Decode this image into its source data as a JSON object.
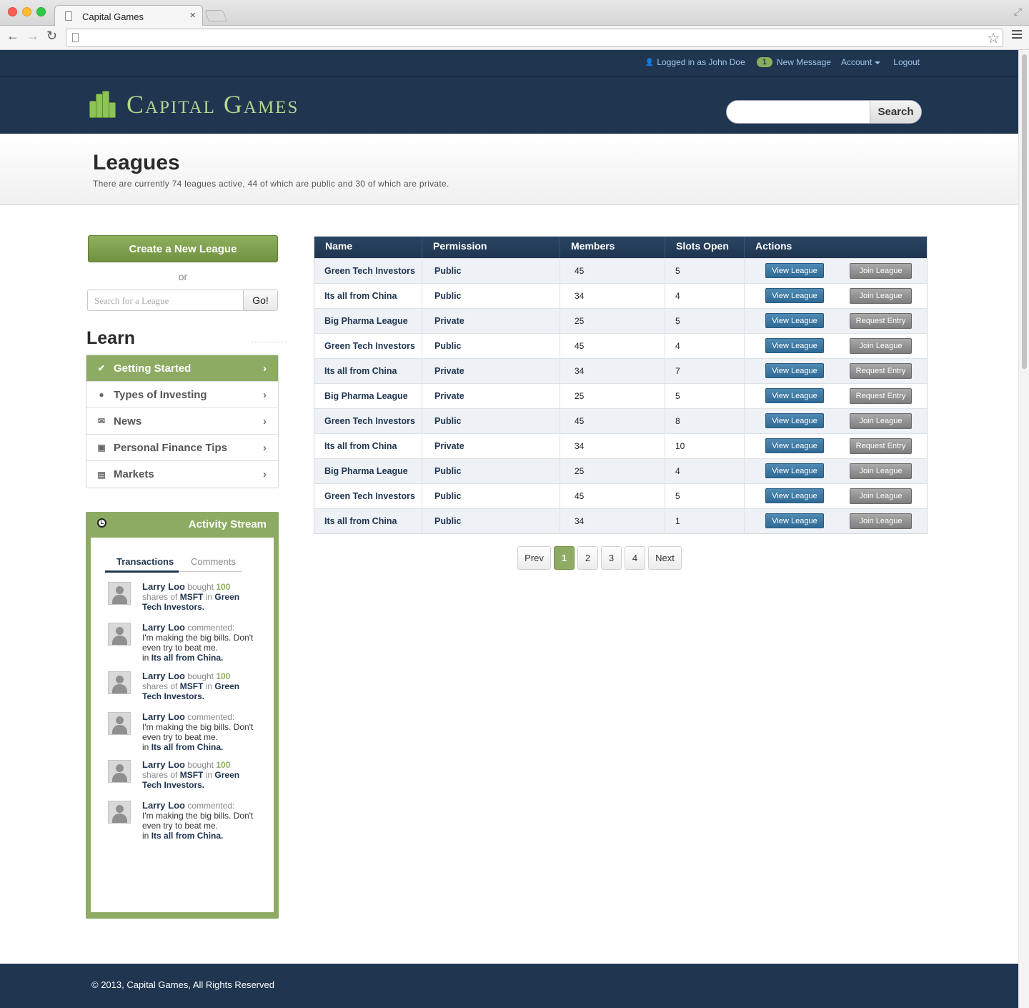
{
  "browser": {
    "tab_title": "Capital Games",
    "tab_close": "×"
  },
  "topbar": {
    "logged_in": "Logged in as John Doe",
    "message_count": "1",
    "new_message": "New Message",
    "account": "Account",
    "logout": "Logout"
  },
  "header": {
    "logo_text": "Capital Games",
    "search_button": "Search"
  },
  "title_band": {
    "title": "Leagues",
    "subtitle": "There are currently 74 leagues active, 44 of which are public and 30 of which are private."
  },
  "sidebar": {
    "create_button": "Create a New League",
    "or": "or",
    "search_placeholder": "Search for a League",
    "go_button": "Go!",
    "learn_title": "Learn",
    "learn_items": [
      {
        "label": "Getting Started",
        "icon": "check-icon"
      },
      {
        "label": "Types of Investing",
        "icon": "person-icon"
      },
      {
        "label": "News",
        "icon": "envelope-icon"
      },
      {
        "label": "Personal Finance Tips",
        "icon": "money-icon"
      },
      {
        "label": "Markets",
        "icon": "chart-icon"
      }
    ]
  },
  "activity": {
    "title": "Activity Stream",
    "tab_transactions": "Transactions",
    "tab_comments": "Comments",
    "feed": [
      {
        "name": "Larry Loo",
        "verb": "bought",
        "num": "100",
        "t1": "shares of",
        "stock": "MSFT",
        "t2": "in",
        "league": "Green Tech Investors."
      },
      {
        "name": "Larry Loo",
        "verb": "commented:",
        "msg": "I'm making the big bills. Don't even try to beat me.",
        "t2": "in",
        "league": "Its all from China."
      },
      {
        "name": "Larry Loo",
        "verb": "bought",
        "num": "100",
        "t1": "shares of",
        "stock": "MSFT",
        "t2": "in",
        "league": "Green Tech Investors."
      },
      {
        "name": "Larry Loo",
        "verb": "commented:",
        "msg": "I'm making the big bills. Don't even try to beat me.",
        "t2": "in",
        "league": "Its all from China."
      },
      {
        "name": "Larry Loo",
        "verb": "bought",
        "num": "100",
        "t1": "shares of",
        "stock": "MSFT",
        "t2": "in",
        "league": "Green Tech Investors."
      },
      {
        "name": "Larry Loo",
        "verb": "commented:",
        "msg": "I'm making the big bills. Don't even try to beat me.",
        "t2": "in",
        "league": "Its all from China."
      }
    ]
  },
  "table": {
    "headers": [
      "Name",
      "Permission",
      "Members",
      "Slots Open",
      "Actions"
    ],
    "view_label": "View League",
    "rows": [
      {
        "name": "Green Tech Investors",
        "perm": "Public",
        "members": "45",
        "slots": "5",
        "action": "Join League"
      },
      {
        "name": "Its all from China",
        "perm": "Public",
        "members": "34",
        "slots": "4",
        "action": "Join League"
      },
      {
        "name": "Big Pharma League",
        "perm": "Private",
        "members": "25",
        "slots": "5",
        "action": "Request Entry"
      },
      {
        "name": "Green Tech Investors",
        "perm": "Public",
        "members": "45",
        "slots": "4",
        "action": "Join League"
      },
      {
        "name": "Its all from China",
        "perm": "Private",
        "members": "34",
        "slots": "7",
        "action": "Request Entry"
      },
      {
        "name": "Big Pharma League",
        "perm": "Private",
        "members": "25",
        "slots": "5",
        "action": "Request Entry"
      },
      {
        "name": "Green Tech Investors",
        "perm": "Public",
        "members": "45",
        "slots": "8",
        "action": "Join League"
      },
      {
        "name": "Its all from China",
        "perm": "Private",
        "members": "34",
        "slots": "10",
        "action": "Request Entry"
      },
      {
        "name": "Big Pharma League",
        "perm": "Public",
        "members": "25",
        "slots": "4",
        "action": "Join League"
      },
      {
        "name": "Green Tech Investors",
        "perm": "Public",
        "members": "45",
        "slots": "5",
        "action": "Join League"
      },
      {
        "name": "Its all from China",
        "perm": "Public",
        "members": "34",
        "slots": "1",
        "action": "Join League"
      }
    ]
  },
  "pager": {
    "prev": "Prev",
    "pages": [
      "1",
      "2",
      "3",
      "4"
    ],
    "current": "1",
    "next": "Next"
  },
  "footer": {
    "text": "© 2013, Capital Games, All Rights Reserved"
  },
  "colors": {
    "navy": "#1f3550",
    "green": "#8dab62",
    "link": "#9fc7ec"
  }
}
